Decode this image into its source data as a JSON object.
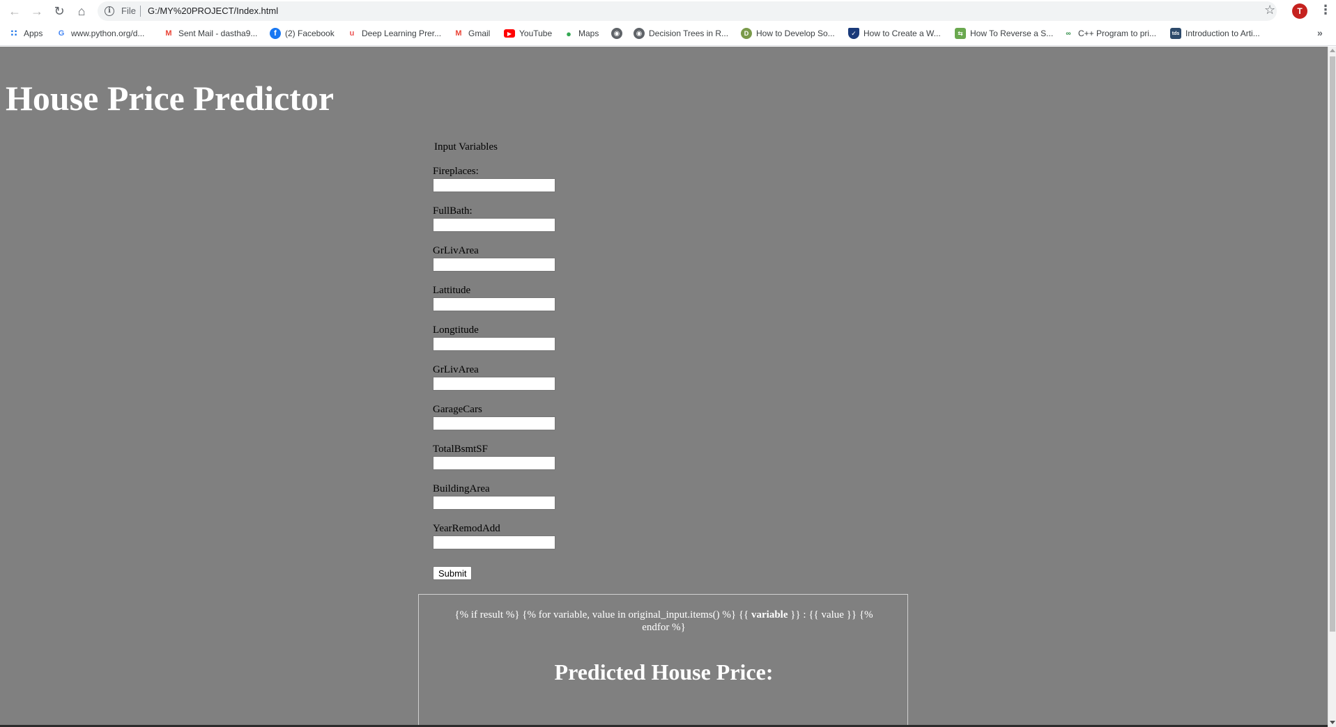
{
  "browser": {
    "url_scheme": "File",
    "url": "G:/MY%20PROJECT/Index.html",
    "profile_initial": "T",
    "bookmarks": [
      {
        "label": "Apps",
        "icon": "apps-grid-icon"
      },
      {
        "label": "www.python.org/d...",
        "icon": "google-icon"
      },
      {
        "label": "Sent Mail - dastha9...",
        "icon": "gmail-icon"
      },
      {
        "label": "(2) Facebook",
        "icon": "facebook-icon"
      },
      {
        "label": "Deep Learning Prer...",
        "icon": "udemy-icon"
      },
      {
        "label": "Gmail",
        "icon": "gmail-icon"
      },
      {
        "label": "YouTube",
        "icon": "youtube-icon"
      },
      {
        "label": "Maps",
        "icon": "maps-pin-icon"
      },
      {
        "label": "",
        "icon": "globe-icon"
      },
      {
        "label": "Decision Trees in R...",
        "icon": "globe-icon"
      },
      {
        "label": "How to Develop So...",
        "icon": "site-icon"
      },
      {
        "label": "How to Create a W...",
        "icon": "shield-icon"
      },
      {
        "label": "How To Reverse a S...",
        "icon": "site-icon"
      },
      {
        "label": "C++ Program to pri...",
        "icon": "gfg-icon"
      },
      {
        "label": "Introduction to Arti...",
        "icon": "site-icon"
      }
    ]
  },
  "page": {
    "title": "House Price Predictor",
    "section_label": "Input Variables",
    "fields": [
      {
        "label": "Fireplaces:",
        "value": ""
      },
      {
        "label": "FullBath:",
        "value": ""
      },
      {
        "label": "GrLivArea",
        "value": ""
      },
      {
        "label": "Lattitude",
        "value": ""
      },
      {
        "label": "Longtitude",
        "value": ""
      },
      {
        "label": "GrLivArea",
        "value": ""
      },
      {
        "label": "GarageCars",
        "value": ""
      },
      {
        "label": "TotalBsmtSF",
        "value": ""
      },
      {
        "label": "BuildingArea",
        "value": ""
      },
      {
        "label": "YearRemodAdd",
        "value": ""
      }
    ],
    "submit_label": "Submit",
    "result": {
      "template_pre": "{% if result %} {% for variable, value in original_input.items() %} {{ ",
      "template_var": "variable",
      "template_post": " }} : {{ value }} {% endfor %}",
      "heading": "Predicted House Price:"
    }
  },
  "colors": {
    "page_background": "#808080",
    "heading_text": "#ffffff"
  }
}
